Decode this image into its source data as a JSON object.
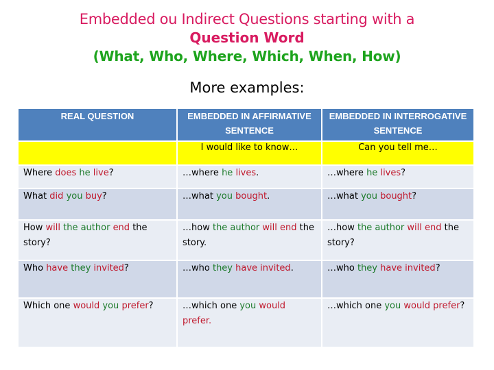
{
  "title": {
    "line1": "Embedded ou Indirect Questions starting with a",
    "line2": "Question Word",
    "line3": "(What, Who, Where, Which, When, How)"
  },
  "subtitle": "More examples:",
  "colors": {
    "title_pink": "#d81b60",
    "title_green": "#1ea41e",
    "header_blue": "#4f81bd",
    "intro_yellow": "#ffff00",
    "row_light": "#e9edf4",
    "row_dark": "#d0d8e8",
    "verb_red": "#c0182c",
    "subject_green": "#1c7a2a"
  },
  "table": {
    "headers": [
      "REAL QUESTION",
      "EMBEDDED IN AFFIRMATIVE SENTENCE",
      "EMBEDDED IN INTERROGATIVE SENTENCE"
    ],
    "intro": [
      "",
      "I would like to know…",
      "Can you tell me…"
    ],
    "rows": [
      [
        [
          {
            "t": "Where ",
            "c": "plain"
          },
          {
            "t": "does",
            "c": "red"
          },
          {
            "t": " ",
            "c": "plain"
          },
          {
            "t": "he",
            "c": "green"
          },
          {
            "t": " ",
            "c": "plain"
          },
          {
            "t": "live",
            "c": "red"
          },
          {
            "t": "?",
            "c": "plain"
          }
        ],
        [
          {
            "t": "…where ",
            "c": "plain"
          },
          {
            "t": "he",
            "c": "green"
          },
          {
            "t": " ",
            "c": "plain"
          },
          {
            "t": "lives",
            "c": "red"
          },
          {
            "t": ".",
            "c": "plain"
          }
        ],
        [
          {
            "t": "…where ",
            "c": "plain"
          },
          {
            "t": "he",
            "c": "green"
          },
          {
            "t": " ",
            "c": "plain"
          },
          {
            "t": "lives",
            "c": "red"
          },
          {
            "t": "?",
            "c": "plain"
          }
        ]
      ],
      [
        [
          {
            "t": "What ",
            "c": "plain"
          },
          {
            "t": "did",
            "c": "red"
          },
          {
            "t": " ",
            "c": "plain"
          },
          {
            "t": "you",
            "c": "green"
          },
          {
            "t": " ",
            "c": "plain"
          },
          {
            "t": "buy",
            "c": "red"
          },
          {
            "t": "?",
            "c": "plain"
          }
        ],
        [
          {
            "t": "…what ",
            "c": "plain"
          },
          {
            "t": "you",
            "c": "green"
          },
          {
            "t": " ",
            "c": "plain"
          },
          {
            "t": "bought",
            "c": "red"
          },
          {
            "t": ".",
            "c": "plain"
          }
        ],
        [
          {
            "t": "…what ",
            "c": "plain"
          },
          {
            "t": "you",
            "c": "green"
          },
          {
            "t": " ",
            "c": "plain"
          },
          {
            "t": "bought",
            "c": "red"
          },
          {
            "t": "?",
            "c": "plain"
          }
        ]
      ],
      [
        [
          {
            "t": "How ",
            "c": "plain"
          },
          {
            "t": "will",
            "c": "red"
          },
          {
            "t": " ",
            "c": "plain"
          },
          {
            "t": "the author",
            "c": "green"
          },
          {
            "t": " ",
            "c": "plain"
          },
          {
            "t": "end",
            "c": "red"
          },
          {
            "t": " the story?",
            "c": "plain"
          }
        ],
        [
          {
            "t": "…how ",
            "c": "plain"
          },
          {
            "t": "the author",
            "c": "green"
          },
          {
            "t": " ",
            "c": "plain"
          },
          {
            "t": "will end",
            "c": "red"
          },
          {
            "t": " the story.",
            "c": "plain"
          }
        ],
        [
          {
            "t": "…how ",
            "c": "plain"
          },
          {
            "t": "the author",
            "c": "green"
          },
          {
            "t": " ",
            "c": "plain"
          },
          {
            "t": "will end",
            "c": "red"
          },
          {
            "t": " the story?",
            "c": "plain"
          }
        ]
      ],
      [
        [
          {
            "t": "Who ",
            "c": "plain"
          },
          {
            "t": "have",
            "c": "red"
          },
          {
            "t": " ",
            "c": "plain"
          },
          {
            "t": "they",
            "c": "green"
          },
          {
            "t": " ",
            "c": "plain"
          },
          {
            "t": "invited",
            "c": "red"
          },
          {
            "t": "?",
            "c": "plain"
          }
        ],
        [
          {
            "t": "…who ",
            "c": "plain"
          },
          {
            "t": "they",
            "c": "green"
          },
          {
            "t": " ",
            "c": "plain"
          },
          {
            "t": "have invited",
            "c": "red"
          },
          {
            "t": ".",
            "c": "plain"
          }
        ],
        [
          {
            "t": "…who ",
            "c": "plain"
          },
          {
            "t": "they",
            "c": "green"
          },
          {
            "t": " ",
            "c": "plain"
          },
          {
            "t": "have invited",
            "c": "red"
          },
          {
            "t": "?",
            "c": "plain"
          }
        ]
      ],
      [
        [
          {
            "t": "Which one ",
            "c": "plain"
          },
          {
            "t": "would",
            "c": "red"
          },
          {
            "t": " ",
            "c": "plain"
          },
          {
            "t": "you",
            "c": "green"
          },
          {
            "t": " ",
            "c": "plain"
          },
          {
            "t": "prefer",
            "c": "red"
          },
          {
            "t": "?",
            "c": "plain"
          }
        ],
        [
          {
            "t": "…which one ",
            "c": "plain"
          },
          {
            "t": "you",
            "c": "green"
          },
          {
            "t": " ",
            "c": "plain"
          },
          {
            "t": "would prefer.",
            "c": "red"
          }
        ],
        [
          {
            "t": "…which one ",
            "c": "plain"
          },
          {
            "t": "you",
            "c": "green"
          },
          {
            "t": " ",
            "c": "plain"
          },
          {
            "t": "would prefer",
            "c": "red"
          },
          {
            "t": "?",
            "c": "plain"
          }
        ]
      ]
    ]
  }
}
